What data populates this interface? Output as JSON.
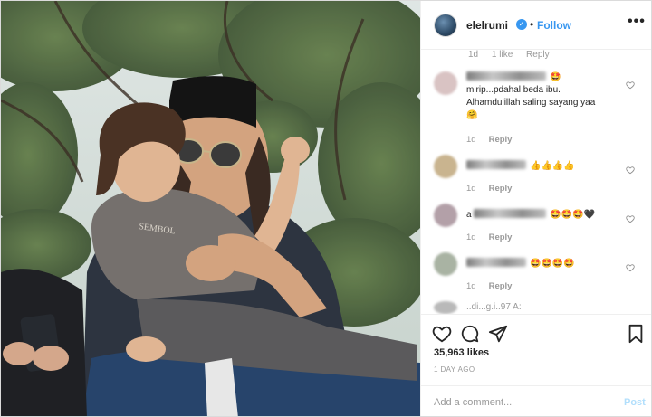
{
  "post": {
    "username": "elelrumi",
    "separator": "•",
    "follow_label": "Follow",
    "more_label": "•••",
    "likes": "35,963 likes",
    "time_ago": "1 DAY AGO"
  },
  "comments_partial": {
    "age": "1d",
    "likes": "1 like",
    "reply": "Reply"
  },
  "comments": [
    {
      "text_lines": [
        "mirip...pdahal beda ibu.",
        "Alhamdulillah saling sayang yaa"
      ],
      "emoji_after_user": "🤩",
      "emoji_line": "🤗",
      "age": "1d",
      "reply": "Reply",
      "avatar_color": "#d9c3c3"
    },
    {
      "emoji_after_user": "👍👍👍👍",
      "age": "1d",
      "reply": "Reply",
      "avatar_color": "#c9b48f"
    },
    {
      "emoji_after_user": "🤩🤩🤩🖤",
      "prefix": "a",
      "age": "1d",
      "reply": "Reply",
      "avatar_color": "#b3a0a8"
    },
    {
      "emoji_after_user": "🤩🤩🤩🤩",
      "age": "1d",
      "reply": "Reply",
      "avatar_color": "#a9b3a3"
    }
  ],
  "comment_faded": {
    "text": "..di...g.i..97 A:"
  },
  "add_comment": {
    "placeholder": "Add a comment...",
    "post_label": "Post"
  },
  "photo": {
    "shirt_text": "SEMBOL"
  },
  "colors": {
    "link_blue": "#3897f0",
    "post_disabled": "#b2dffc",
    "secondary_text": "#999999"
  }
}
